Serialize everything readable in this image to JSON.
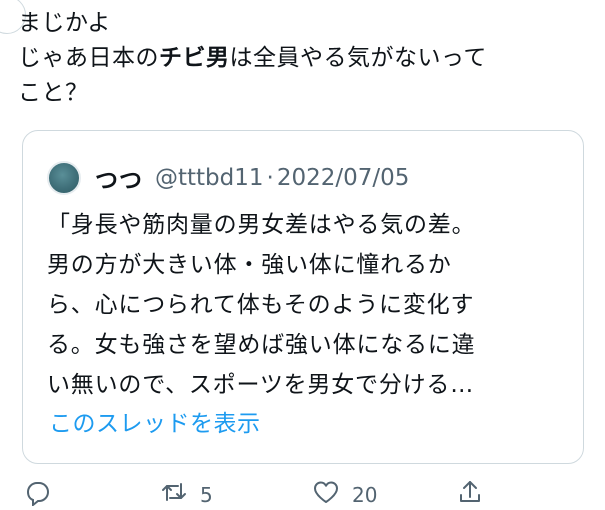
{
  "tweet": {
    "line1": "まじかよ",
    "line2_prefix": "じゃあ日本の",
    "line2_bold": "チビ男",
    "line2_suffix": "は全員やる気がないって",
    "line3": "こと？"
  },
  "quote": {
    "author_name": "つつ",
    "author_handle": "@tttbd11",
    "separator": "·",
    "date": "2022/07/05",
    "body_lines": [
      "「身長や筋肉量の男女差はやる気の差。",
      "男の方が大きい体・強い体に憧れるか",
      "ら、心につられて体もそのように変化す",
      "る。女も強さを望めば強い体になるに違",
      "い無いので、スポーツを男女で分ける…"
    ],
    "thread_link": "このスレッドを表示"
  },
  "actions": {
    "reply_icon": "reply-icon",
    "retweet_icon": "retweet-icon",
    "retweet_count": "5",
    "like_icon": "heart-icon",
    "like_count": "20",
    "share_icon": "share-icon"
  },
  "colors": {
    "text": "#0f1419",
    "secondary": "#536471",
    "link": "#1d9bf0",
    "border": "#cfd9de"
  }
}
